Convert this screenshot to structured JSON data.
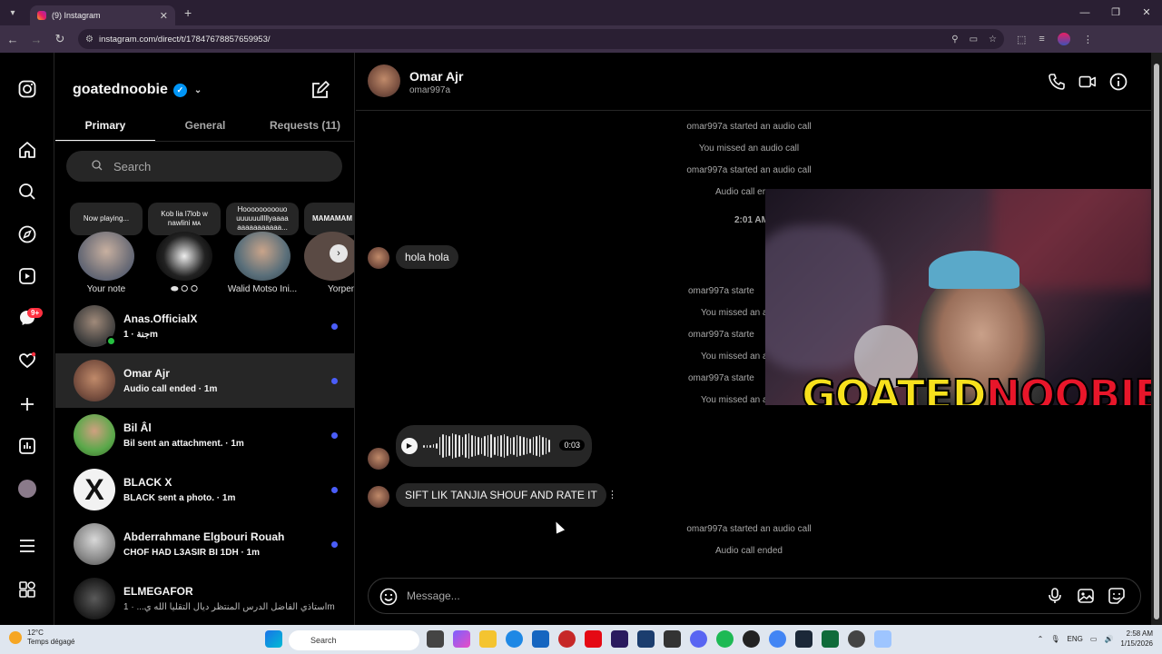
{
  "browser": {
    "tab_title": "(9) Instagram",
    "url": "instagram.com/direct/t/17847678857659953/"
  },
  "inbox": {
    "username": "goatednoobie",
    "tabs": [
      "Primary",
      "General",
      "Requests (11)"
    ],
    "search_placeholder": "Search",
    "notes": [
      {
        "bubble": "Now playing...",
        "name": "Your note"
      },
      {
        "bubble": "Kob lia l7lob w nawlini ᴍᴀ",
        "name": "⬬ ⭘ ⭘"
      },
      {
        "bubble": "Hooooooooouo uuuuuulllllyaaaa aaaaaaaaaaa...",
        "name": "Walid Motso Ini..."
      },
      {
        "bubble": "MAMAMAM",
        "name": "Yorpen"
      }
    ],
    "threads": [
      {
        "name": "Anas.OfficialX",
        "preview": "جنة · 1m",
        "unread": true,
        "online": true,
        "selected": false
      },
      {
        "name": "Omar Ajr",
        "preview": "Audio call ended · 1m",
        "unread": true,
        "online": false,
        "selected": true
      },
      {
        "name": "Bil Âl",
        "preview": "Bil sent an attachment. · 1m",
        "unread": true,
        "online": false,
        "selected": false
      },
      {
        "name": "BLACK X",
        "preview": "BLACK sent a photo. · 1m",
        "unread": true,
        "online": false,
        "selected": false
      },
      {
        "name": "Abderrahmane Elgbouri Rouah",
        "preview": "CHOF HAD L3ASIR BI 1DH · 1m",
        "unread": true,
        "online": false,
        "selected": false
      },
      {
        "name": "ELMEGAFOR",
        "preview": "استاذي الفاضل الدرس المنتظر ديال التقليا الله ي... · 1m",
        "unread": false,
        "online": false,
        "selected": false
      }
    ],
    "rail_badge": "9+"
  },
  "chat": {
    "name": "Omar Ajr",
    "handle": "omar997a",
    "system_messages": [
      "omar997a started an audio call",
      "You missed an audio call",
      "omar997a started an audio call",
      "Audio call er",
      "2:01 AM",
      "omar997a starte",
      "You missed an a",
      "omar997a starte",
      "You missed an a",
      "omar997a starte",
      "You missed an a",
      "omar997a started an audio call",
      "Audio call ended"
    ],
    "msg_hola": "hola hola",
    "voice_duration": "0:03",
    "msg_sift": "SIFT LIK TANJIA SHOUF AND RATE IT",
    "composer_placeholder": "Message..."
  },
  "overlay": {
    "part1": "GOATED",
    "part2": "NOOBIE"
  },
  "taskbar": {
    "temp": "12°C",
    "weather": "Temps dégagé",
    "search": "Search",
    "lang": "ENG",
    "time": "2:58 AM",
    "date": "1/15/2026"
  },
  "colors": {
    "accent": "#4a5df9",
    "verified": "#0095f6",
    "badge": "#ff3040",
    "overlay_yellow": "#f7e01c",
    "overlay_red": "#e8162a"
  }
}
